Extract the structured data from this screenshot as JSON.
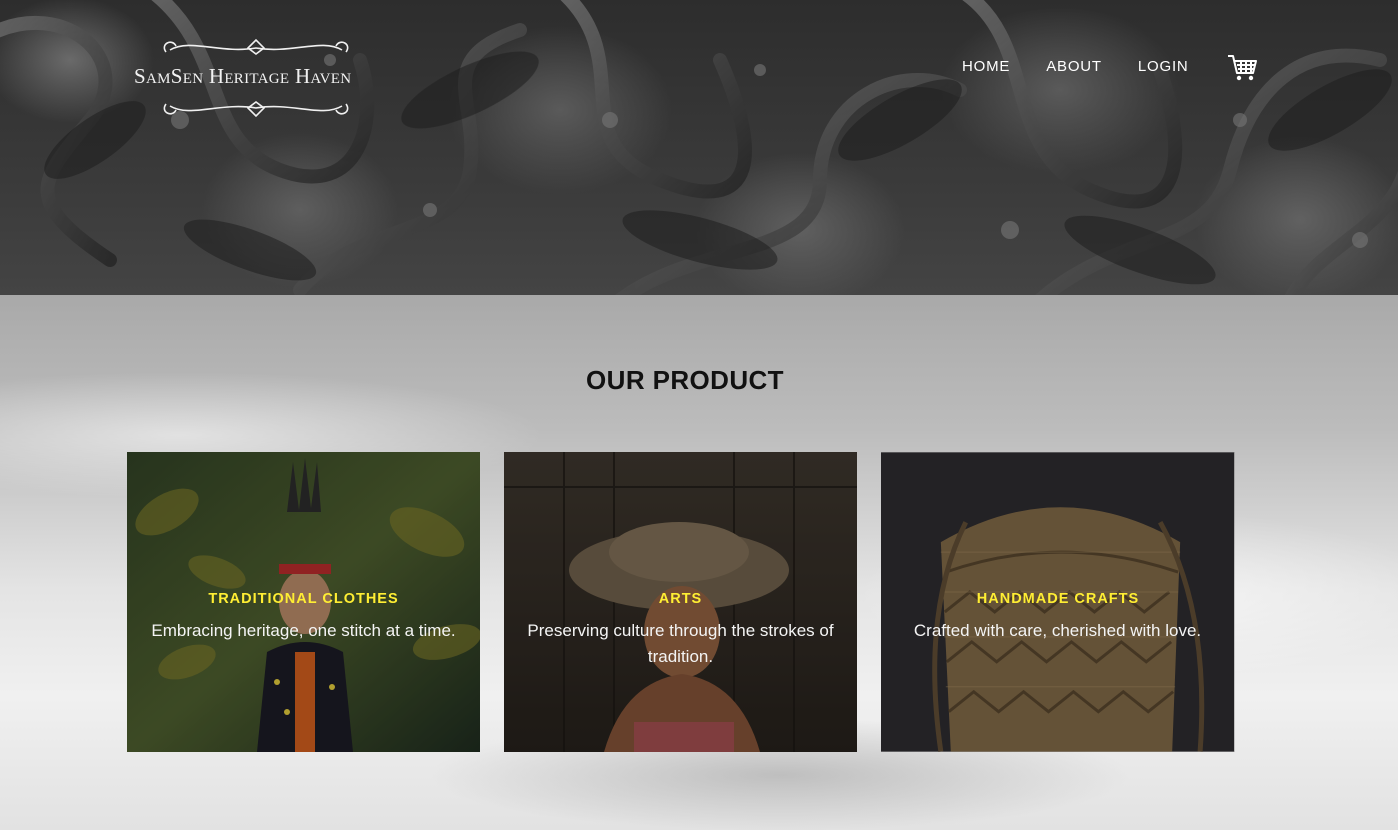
{
  "brand": {
    "logo_text": "SamSen Heritage Haven"
  },
  "nav": {
    "items": [
      {
        "label": "HOME"
      },
      {
        "label": "ABOUT"
      },
      {
        "label": "LOGIN"
      }
    ],
    "cart_icon": "shopping-cart-icon"
  },
  "products": {
    "heading": "OUR PRODUCT",
    "cards": [
      {
        "title": "TRADITIONAL CLOTHES",
        "description": "Embracing heritage, one stitch at a time.",
        "image": "woman-in-traditional-feathered-headdress"
      },
      {
        "title": "ARTS",
        "description": "Preserving culture through the strokes of tradition.",
        "image": "elderly-woman-with-wide-hat"
      },
      {
        "title": "HANDMADE CRAFTS",
        "description": "Crafted with care, cherished with love.",
        "image": "woven-rattan-basket"
      }
    ]
  },
  "colors": {
    "card_title": "#ffee33",
    "nav_text": "#ffffff",
    "hero_bg": "#333333"
  }
}
